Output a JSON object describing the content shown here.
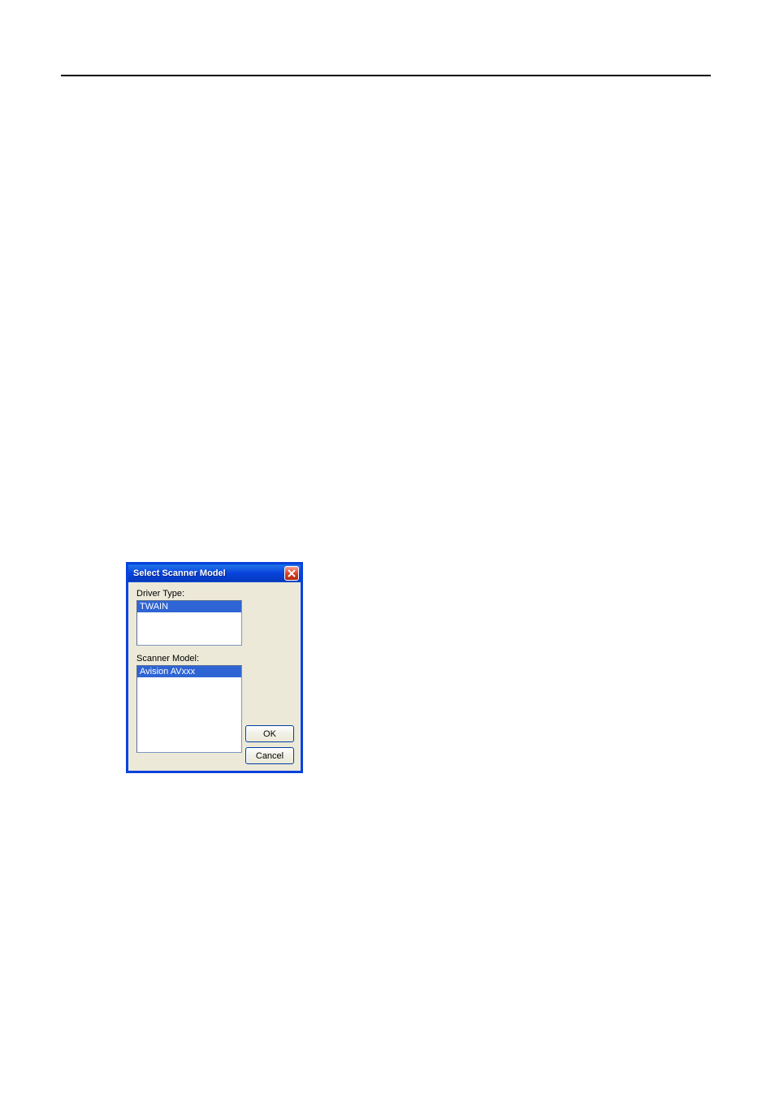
{
  "dialog": {
    "title": "Select Scanner Model",
    "driver_label": "Driver Type:",
    "scanner_label": "Scanner Model:",
    "driver_items": [
      "TWAIN"
    ],
    "scanner_items": [
      "Avision AVxxx"
    ],
    "ok_label": "OK",
    "cancel_label": "Cancel"
  },
  "colors": {
    "titlebar_blue": "#0842dd",
    "selection_blue": "#2f64d4",
    "dialog_bg": "#ece9d8",
    "close_red": "#e04530"
  }
}
